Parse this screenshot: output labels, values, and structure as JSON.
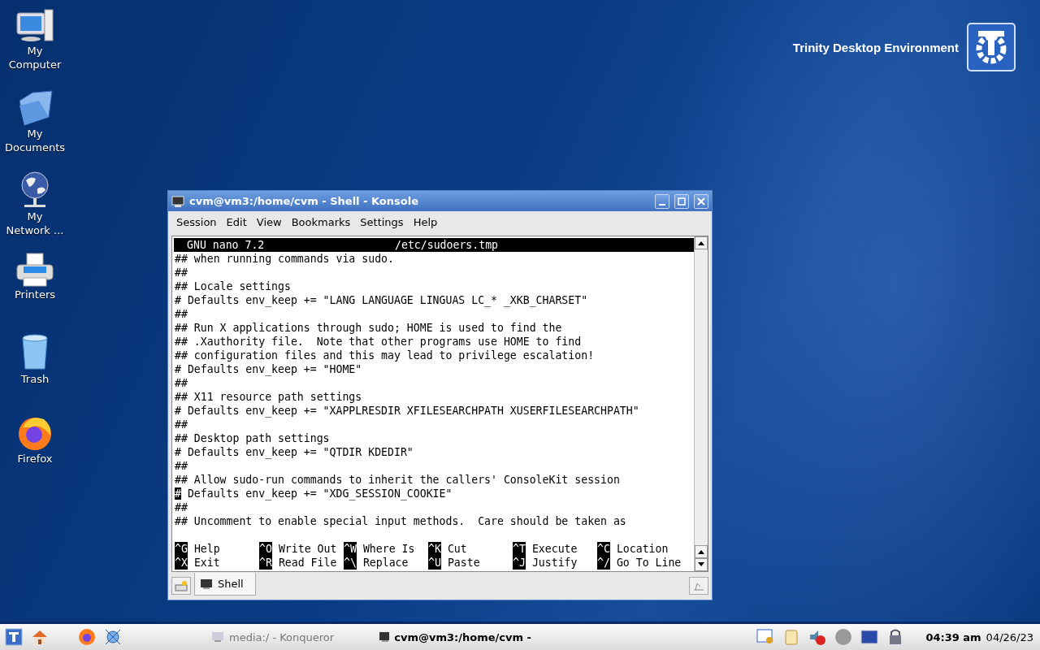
{
  "desktop": {
    "logo_text": "Trinity Desktop Environment",
    "icons": [
      {
        "kind": "computer",
        "label": "My\nComputer"
      },
      {
        "kind": "documents",
        "label": "My\nDocuments"
      },
      {
        "kind": "network",
        "label": "My\nNetwork ..."
      },
      {
        "kind": "printer",
        "label": "Printers"
      },
      {
        "kind": "trash",
        "label": "Trash"
      },
      {
        "kind": "firefox",
        "label": "Firefox"
      }
    ]
  },
  "window": {
    "title": "cvm@vm3:/home/cvm - Shell - Konsole",
    "menu": [
      "Session",
      "Edit",
      "View",
      "Bookmarks",
      "Settings",
      "Help"
    ],
    "terminal": {
      "app_title": "GNU nano 7.2",
      "file": "/etc/sudoers.tmp",
      "lines": [
        {
          "text": "## when running commands via sudo.",
          "cursor": false
        },
        {
          "text": "##",
          "cursor": false
        },
        {
          "text": "## Locale settings",
          "cursor": false
        },
        {
          "text": "# Defaults env_keep += \"LANG LANGUAGE LINGUAS LC_* _XKB_CHARSET\"",
          "cursor": false
        },
        {
          "text": "##",
          "cursor": false
        },
        {
          "text": "## Run X applications through sudo; HOME is used to find the",
          "cursor": false
        },
        {
          "text": "## .Xauthority file.  Note that other programs use HOME to find",
          "cursor": false
        },
        {
          "text": "## configuration files and this may lead to privilege escalation!",
          "cursor": false
        },
        {
          "text": "# Defaults env_keep += \"HOME\"",
          "cursor": false
        },
        {
          "text": "##",
          "cursor": false
        },
        {
          "text": "## X11 resource path settings",
          "cursor": false
        },
        {
          "text": "# Defaults env_keep += \"XAPPLRESDIR XFILESEARCHPATH XUSERFILESEARCHPATH\"",
          "cursor": false
        },
        {
          "text": "##",
          "cursor": false
        },
        {
          "text": "## Desktop path settings",
          "cursor": false
        },
        {
          "text": "# Defaults env_keep += \"QTDIR KDEDIR\"",
          "cursor": false
        },
        {
          "text": "##",
          "cursor": false
        },
        {
          "text": "## Allow sudo-run commands to inherit the callers' ConsoleKit session",
          "cursor": false
        },
        {
          "text": "# Defaults env_keep += \"XDG_SESSION_COOKIE\"",
          "cursor": true
        },
        {
          "text": "##",
          "cursor": false
        },
        {
          "text": "## Uncomment to enable special input methods.  Care should be taken as",
          "cursor": false
        }
      ],
      "shortcuts": [
        [
          {
            "key": "^G",
            "label": "Help"
          },
          {
            "key": "^O",
            "label": "Write Out"
          },
          {
            "key": "^W",
            "label": "Where Is"
          },
          {
            "key": "^K",
            "label": "Cut"
          },
          {
            "key": "^T",
            "label": "Execute"
          },
          {
            "key": "^C",
            "label": "Location"
          }
        ],
        [
          {
            "key": "^X",
            "label": "Exit"
          },
          {
            "key": "^R",
            "label": "Read File"
          },
          {
            "key": "^\\",
            "label": "Replace"
          },
          {
            "key": "^U",
            "label": "Paste"
          },
          {
            "key": "^J",
            "label": "Justify"
          },
          {
            "key": "^/",
            "label": "Go To Line"
          }
        ]
      ]
    },
    "tabs": [
      {
        "label": "Shell",
        "selected": true
      }
    ]
  },
  "taskbar": {
    "tasks": [
      {
        "label": "media:/ - Konqueror",
        "selected": false
      },
      {
        "label": "cvm@vm3:/home/cvm -",
        "selected": true
      }
    ],
    "time": "04:39 am",
    "date": "04/26/23"
  }
}
